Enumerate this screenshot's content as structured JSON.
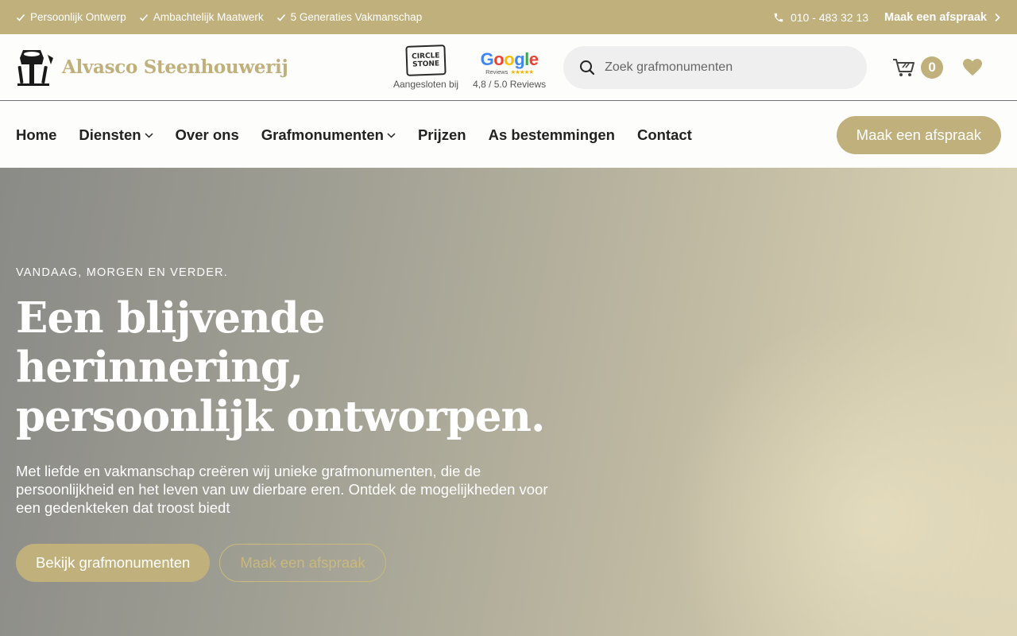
{
  "colors": {
    "accent": "#bfb07c",
    "text_dark": "#222222",
    "search_bg": "#efefef"
  },
  "topbar": {
    "usps": [
      {
        "icon": "check-icon",
        "label": "Persoonlijk Ontwerp"
      },
      {
        "icon": "check-icon",
        "label": "Ambachtelijk Maatwerk"
      },
      {
        "icon": "check-icon",
        "label": "5 Generaties Vakmanschap"
      }
    ],
    "phone": {
      "icon": "phone-icon",
      "label": "010 - 483 32 13"
    },
    "appointment": {
      "label": "Maak een afspraak",
      "icon": "chevron-right-icon"
    }
  },
  "header": {
    "logo_text": "Alvasco Steenhouwerij",
    "logo_icon": "stonemason-tools-icon",
    "circle_stone": {
      "line1": "CIRCLE",
      "line2": "STONE",
      "caption": "Aangesloten bij"
    },
    "google": {
      "word": [
        "G",
        "o",
        "o",
        "g",
        "l",
        "e"
      ],
      "sub": "Reviews",
      "stars": "★★★★★",
      "caption": "4,8 / 5.0 Reviews"
    },
    "search": {
      "placeholder": "Zoek grafmonumenten",
      "value": "",
      "icon": "search-icon"
    },
    "cart": {
      "icon": "cart-icon",
      "count": "0"
    },
    "wishlist_icon": "heart-icon"
  },
  "nav": {
    "items": [
      {
        "label": "Home",
        "dropdown": false
      },
      {
        "label": "Diensten",
        "dropdown": true
      },
      {
        "label": "Over ons",
        "dropdown": false
      },
      {
        "label": "Grafmonumenten",
        "dropdown": true
      },
      {
        "label": "Prijzen",
        "dropdown": false
      },
      {
        "label": "As bestemmingen",
        "dropdown": false
      },
      {
        "label": "Contact",
        "dropdown": false
      }
    ],
    "cta": "Maak een afspraak"
  },
  "hero": {
    "eyebrow": "VANDAAG, MORGEN EN VERDER.",
    "title_line1": "Een blijvende herinnering,",
    "title_line2": "persoonlijk ontworpen.",
    "text": "Met liefde en vakmanschap creëren wij unieke grafmonumenten, die de persoonlijkheid en het leven van uw dierbare eren. Ontdek de mogelijkheden voor een gedenkteken dat troost biedt",
    "primary_button": "Bekijk grafmonumenten",
    "secondary_button": "Maak een afspraak"
  }
}
